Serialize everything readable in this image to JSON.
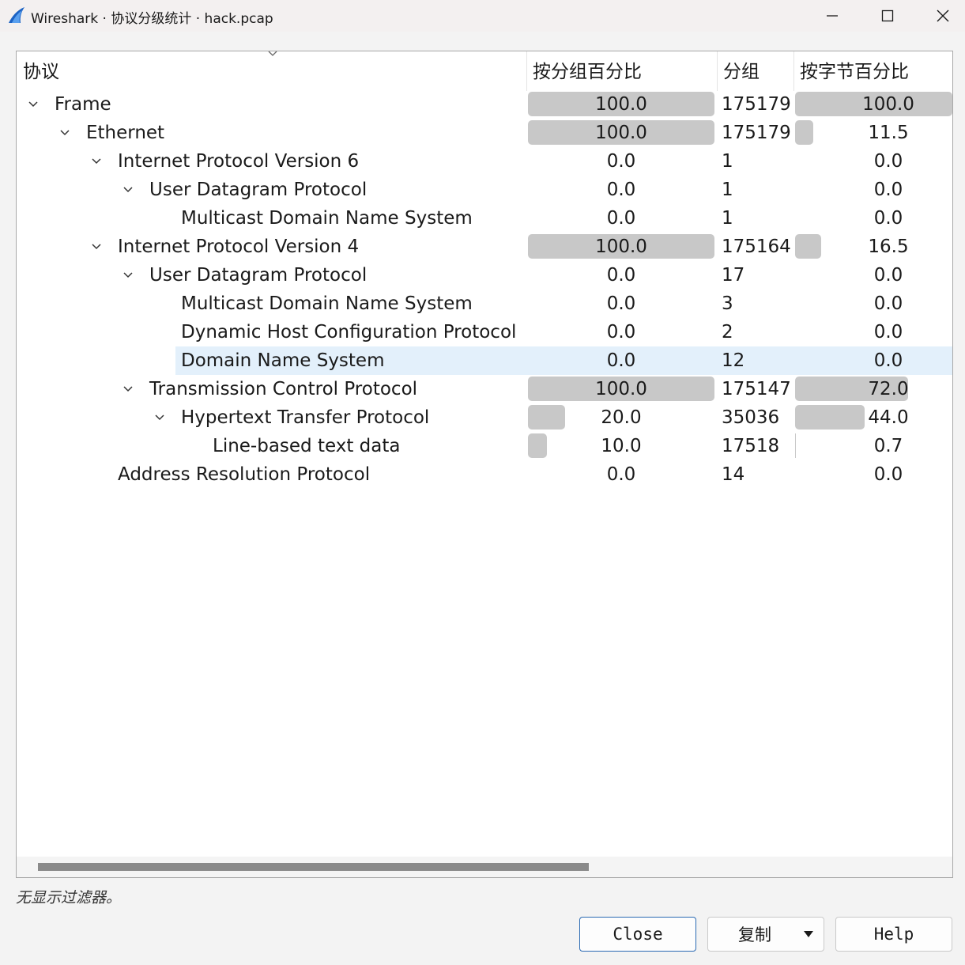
{
  "window": {
    "title": "Wireshark · 协议分级统计 · hack.pcap",
    "icon": "wireshark-fin-icon"
  },
  "columns": {
    "protocol": "协议",
    "percent_packets": "按分组百分比",
    "packets": "分组",
    "percent_bytes": "按字节百分比"
  },
  "rows": [
    {
      "name": "Frame",
      "depth": 0,
      "expanded": true,
      "pct_packets": "100.0",
      "pct_packets_value": 100.0,
      "packets": "175179",
      "pct_bytes": "100.0",
      "pct_bytes_value": 100.0
    },
    {
      "name": "Ethernet",
      "depth": 1,
      "expanded": true,
      "pct_packets": "100.0",
      "pct_packets_value": 100.0,
      "packets": "175179",
      "pct_bytes": "11.5",
      "pct_bytes_value": 11.5
    },
    {
      "name": "Internet Protocol Version 6",
      "depth": 2,
      "expanded": true,
      "pct_packets": "0.0",
      "pct_packets_value": 0.0,
      "packets": "1",
      "pct_bytes": "0.0",
      "pct_bytes_value": 0.0
    },
    {
      "name": "User Datagram Protocol",
      "depth": 3,
      "expanded": true,
      "pct_packets": "0.0",
      "pct_packets_value": 0.0,
      "packets": "1",
      "pct_bytes": "0.0",
      "pct_bytes_value": 0.0
    },
    {
      "name": "Multicast Domain Name System",
      "depth": 4,
      "expanded": null,
      "pct_packets": "0.0",
      "pct_packets_value": 0.0,
      "packets": "1",
      "pct_bytes": "0.0",
      "pct_bytes_value": 0.0
    },
    {
      "name": "Internet Protocol Version 4",
      "depth": 2,
      "expanded": true,
      "pct_packets": "100.0",
      "pct_packets_value": 100.0,
      "packets": "175164",
      "pct_bytes": "16.5",
      "pct_bytes_value": 16.5
    },
    {
      "name": "User Datagram Protocol",
      "depth": 3,
      "expanded": true,
      "pct_packets": "0.0",
      "pct_packets_value": 0.0,
      "packets": "17",
      "pct_bytes": "0.0",
      "pct_bytes_value": 0.0
    },
    {
      "name": "Multicast Domain Name System",
      "depth": 4,
      "expanded": null,
      "pct_packets": "0.0",
      "pct_packets_value": 0.0,
      "packets": "3",
      "pct_bytes": "0.0",
      "pct_bytes_value": 0.0
    },
    {
      "name": "Dynamic Host Configuration Protocol",
      "depth": 4,
      "expanded": null,
      "pct_packets": "0.0",
      "pct_packets_value": 0.0,
      "packets": "2",
      "pct_bytes": "0.0",
      "pct_bytes_value": 0.0
    },
    {
      "name": "Domain Name System",
      "depth": 4,
      "expanded": null,
      "selected": true,
      "pct_packets": "0.0",
      "pct_packets_value": 0.0,
      "packets": "12",
      "pct_bytes": "0.0",
      "pct_bytes_value": 0.0
    },
    {
      "name": "Transmission Control Protocol",
      "depth": 3,
      "expanded": true,
      "pct_packets": "100.0",
      "pct_packets_value": 100.0,
      "packets": "175147",
      "pct_bytes": "72.0",
      "pct_bytes_value": 72.0
    },
    {
      "name": "Hypertext Transfer Protocol",
      "depth": 4,
      "expanded": true,
      "pct_packets": "20.0",
      "pct_packets_value": 20.0,
      "packets": "35036",
      "pct_bytes": "44.0",
      "pct_bytes_value": 44.0
    },
    {
      "name": "Line-based text data",
      "depth": 5,
      "expanded": null,
      "pct_packets": "10.0",
      "pct_packets_value": 10.0,
      "packets": "17518",
      "pct_bytes": "0.7",
      "pct_bytes_value": 0.7
    },
    {
      "name": "Address Resolution Protocol",
      "depth": 2,
      "expanded": null,
      "pct_packets": "0.0",
      "pct_packets_value": 0.0,
      "packets": "14",
      "pct_bytes": "0.0",
      "pct_bytes_value": 0.0
    }
  ],
  "status": {
    "filter_text": "无显示过滤器。"
  },
  "buttons": {
    "close": "Close",
    "copy": "复制",
    "help": "Help"
  },
  "colors": {
    "bar": "#c8c8c8",
    "selection": "#e3f0fb",
    "primary_border": "#2b6ab3"
  }
}
